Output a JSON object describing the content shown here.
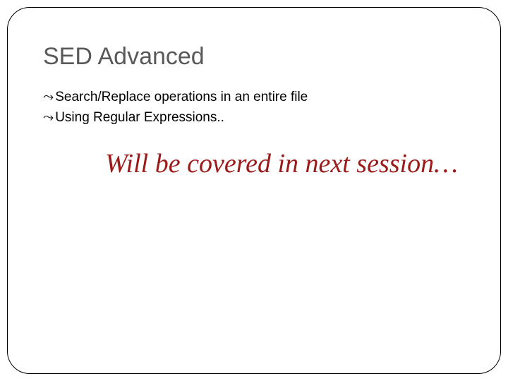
{
  "slide": {
    "title": "SED Advanced",
    "bullets": [
      "Search/Replace operations in an entire file",
      "Using Regular Expressions.."
    ],
    "subtitle": "Will be covered in next session…"
  }
}
